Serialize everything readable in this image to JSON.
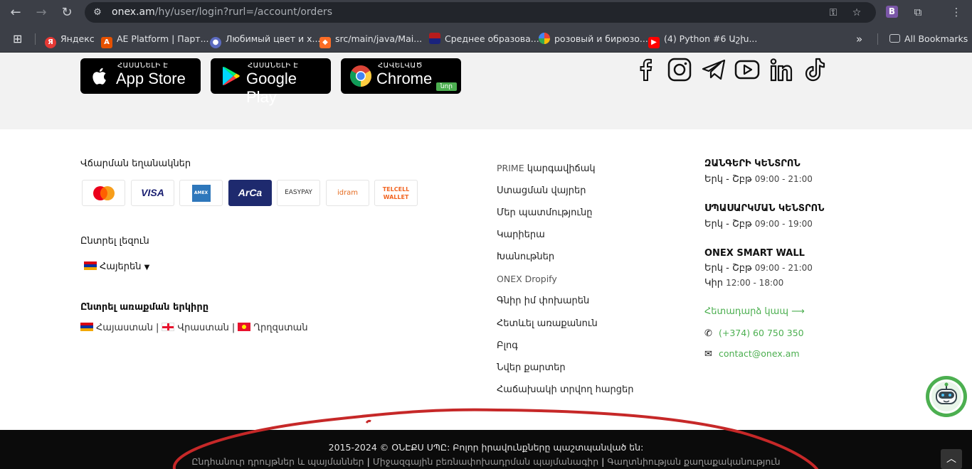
{
  "browser": {
    "url_host": "onex.am",
    "url_path": "/hy/user/login?rurl=/account/orders",
    "bookmarks": [
      {
        "label": "Яндекс",
        "icon": "yandex-icon",
        "color": "#e53935"
      },
      {
        "label": "AE Platform | Парт...",
        "icon": "ae-platform-icon",
        "color": "#e65100"
      },
      {
        "label": "Любимый цвет и х...",
        "icon": "person-icon",
        "color": "#5c6bc0"
      },
      {
        "label": "src/main/java/Mai...",
        "icon": "gitlab-icon",
        "color": "#fc6d26"
      },
      {
        "label": "Среднее образова...",
        "icon": "flag-us-icon",
        "color": "#b71c1c"
      },
      {
        "label": "розовый и бирюзо...",
        "icon": "google-icon",
        "color": "#4285f4"
      },
      {
        "label": "(4) Python #6 Աշխ...",
        "icon": "youtube-icon",
        "color": "#ff0000"
      }
    ],
    "all_bookmarks": "All Bookmarks"
  },
  "stores": [
    {
      "small": "ՀԱՍԱՆԵԼԻ Է",
      "big": "App Store",
      "icon": "apple-icon"
    },
    {
      "small": "ՀԱՍԱՆԵԼԻ Է",
      "big": "Google Play",
      "icon": "google-play-icon"
    },
    {
      "small": "ՀԱՎԵԼՎԱԾ",
      "big": "Chrome",
      "icon": "chrome-icon",
      "tag": "նոր"
    }
  ],
  "payment": {
    "title": "Վճարման եղանակներ",
    "methods": [
      "MasterCard",
      "VISA",
      "AMEX",
      "ArCa",
      "EASYPAY",
      "idram",
      "TELCELL WALLET"
    ]
  },
  "language": {
    "title": "Ընտրել լեզուն",
    "selected": "Հայերեն"
  },
  "country": {
    "title": "Ընտրել առաքման երկիրը",
    "list": [
      "Հայաստան",
      "Վրաստան",
      "Ղրղզստան"
    ]
  },
  "menu": {
    "prime_latin": "PRIME",
    "prime_rest": " կարգավիճակ",
    "items": [
      "Ստացման վայրեր",
      "Մեր պատմությունը",
      "Կարիերա",
      "Խանութներ"
    ],
    "dropify": "ONEX Dropify",
    "items2": [
      "Գնիր իմ փոխարեն",
      "Հետևել առաքանուն",
      "Բլոգ",
      "Նվեր քարտեր",
      "Հաճախակի տրվող հարցեր"
    ]
  },
  "contacts": {
    "call_center": "ԶԱՆԳԵՐԻ ԿԵՆՏՐՈՆ",
    "call_days": "Երկ - Շբթ",
    "call_hours": "09:00 - 21:00",
    "service_center": "ՍՊԱՍԱՐԿՄԱՆ ԿԵՆՏՐՈՆ",
    "service_days": "Երկ - Շբթ",
    "service_hours": "09:00 - 19:00",
    "smart_wall": "ONEX SMART WALL",
    "wall_days": "Երկ - Շբթ",
    "wall_hours": "09:00 - 21:00",
    "wall_sun": "Կիր",
    "wall_sun_hours": "12:00 - 18:00",
    "feedback": "Հետադարձ կապ ⟶",
    "phone": "(+374) 60 750 350",
    "email": "contact@onex.am"
  },
  "bottom": {
    "copyright": "2015-2024 © ՕՆԷՔՍ ՍՊԸ: Բոլոր իրավունքները պաշտպանված են:",
    "links": [
      "Ընդհանուր դրույթներ և պայմաններ",
      "Միջազգային բեռնափոխադրման պայմանագիր",
      "Գաղտնիության քաղաքականություն"
    ]
  },
  "colors": {
    "accent": "#4caf50",
    "annotation": "#c62828"
  }
}
